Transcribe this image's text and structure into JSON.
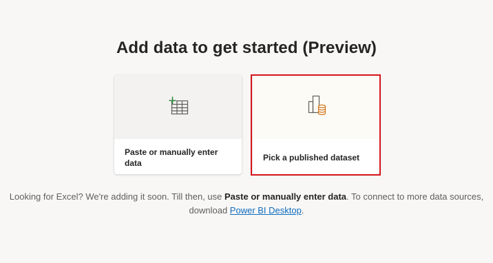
{
  "page": {
    "title": "Add data to get started (Preview)"
  },
  "cards": [
    {
      "label": "Paste or manually enter data",
      "icon": "table-add-icon"
    },
    {
      "label": "Pick a published dataset",
      "icon": "dataset-icon"
    }
  ],
  "info": {
    "prefix": "Looking for Excel? We're adding it soon. Till then, use ",
    "emphasis": "Paste or manually enter data",
    "middle": ". To connect to more data sources, download ",
    "link": "Power BI Desktop",
    "suffix": "."
  },
  "colors": {
    "background": "#f8f7f6",
    "highlight_border": "#d6141a",
    "link": "#0f6cbd",
    "icon_green": "#2e8a3e",
    "icon_orange": "#d0781d"
  }
}
